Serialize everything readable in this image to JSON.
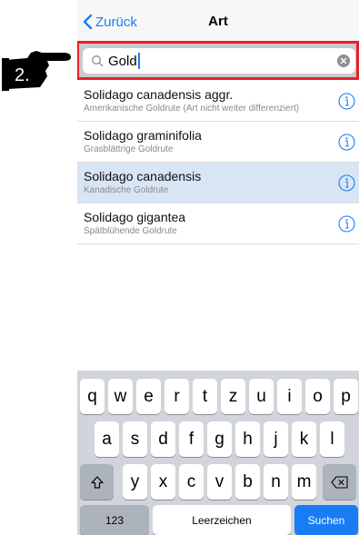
{
  "navbar": {
    "back_label": "Zurück",
    "title": "Art"
  },
  "search": {
    "value": "Gold"
  },
  "annotation": {
    "step_label": "2."
  },
  "list": {
    "items": [
      {
        "title": "Solidago canadensis aggr.",
        "subtitle": "Amerikanische Goldrute (Art nicht weiter differenziert)",
        "selected": false
      },
      {
        "title": "Solidago graminifolia",
        "subtitle": "Grasblättrige Goldrute",
        "selected": false
      },
      {
        "title": "Solidago canadensis",
        "subtitle": "Kanadische Goldrute",
        "selected": true
      },
      {
        "title": "Solidago gigantea",
        "subtitle": "Spätblühende Goldrute",
        "selected": false
      }
    ]
  },
  "keyboard": {
    "row1": [
      "q",
      "w",
      "e",
      "r",
      "t",
      "z",
      "u",
      "i",
      "o",
      "p"
    ],
    "row2": [
      "a",
      "s",
      "d",
      "f",
      "g",
      "h",
      "j",
      "k",
      "l"
    ],
    "row3": [
      "y",
      "x",
      "c",
      "v",
      "b",
      "n",
      "m"
    ],
    "numbers_label": "123",
    "space_label": "Leerzeichen",
    "search_label": "Suchen"
  },
  "colors": {
    "accent": "#1a7cf5",
    "selected_row": "#d7e5f5",
    "highlight_border": "#e8202a"
  }
}
